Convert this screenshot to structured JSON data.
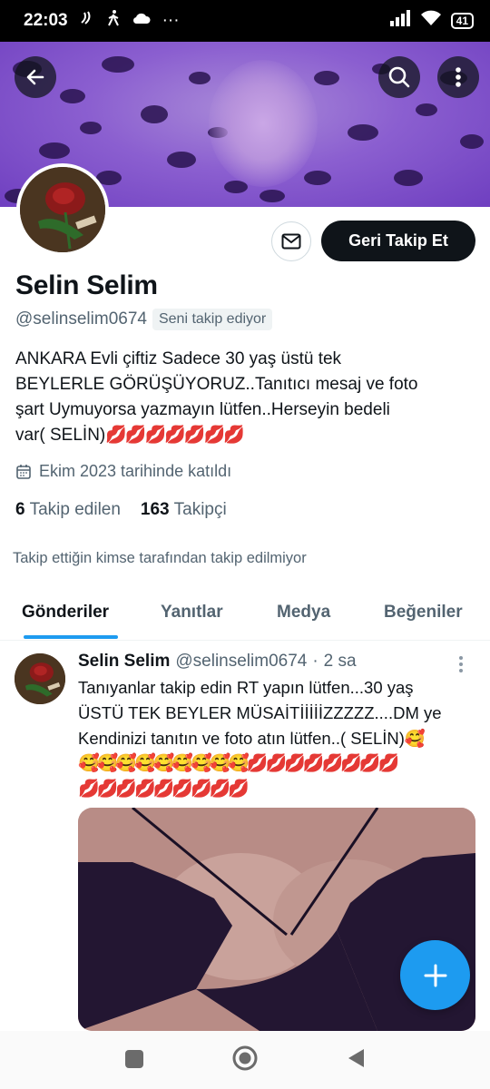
{
  "status_bar": {
    "time": "22:03",
    "left_icons": [
      "nfc-icon",
      "walking-icon",
      "cloud-icon"
    ],
    "more": "···",
    "battery": "41"
  },
  "profile": {
    "display_name": "Selin Selim",
    "handle": "@selinselim0674",
    "follows_you_badge": "Seni takip ediyor",
    "bio_lines": [
      "ANKARA Evli çiftiz Sadece 30 yaş üstü tek",
      "BEYLERLE GÖRÜŞÜYORUZ..Tanıtıcı mesaj ve foto",
      "şart Uymuyorsa yazmayın lütfen..Herseyin bedeli",
      "var( SELİN)"
    ],
    "bio_emojis": "💋💋💋💋💋💋💋",
    "joined": "Ekim 2023 tarihinde katıldı",
    "following_count": "6",
    "following_label": "Takip edilen",
    "followers_count": "163",
    "followers_label": "Takipçi",
    "not_followed_note": "Takip ettiğin kimse tarafından takip edilmiyor",
    "follow_back_label": "Geri Takip Et"
  },
  "tabs": [
    {
      "label": "Gönderiler",
      "active": true
    },
    {
      "label": "Yanıtlar",
      "active": false
    },
    {
      "label": "Medya",
      "active": false
    },
    {
      "label": "Beğeniler",
      "active": false
    }
  ],
  "tweet": {
    "name": "Selin Selim",
    "handle": "@selinselim0674",
    "dot": "·",
    "time": "2 sa",
    "text_lines": [
      "Tanıyanlar takip edin RT yapın lütfen...30 yaş",
      "ÜSTÜ TEK BEYLER MÜSAİTİİİİİZZZZZ....DM ye",
      "Kendinizi tanıtın ve foto atın lütfen..( SELİN)🥰"
    ],
    "emoji_line_1": "🥰🥰🥰🥰🥰🥰🥰🥰🥰💋💋💋💋💋💋💋💋",
    "emoji_line_2": "💋💋💋💋💋💋💋💋💋"
  },
  "colors": {
    "accent": "#1d9bf0",
    "text_primary": "#0f1419",
    "text_secondary": "#536471",
    "banner_purple": "#8b5fd0"
  }
}
